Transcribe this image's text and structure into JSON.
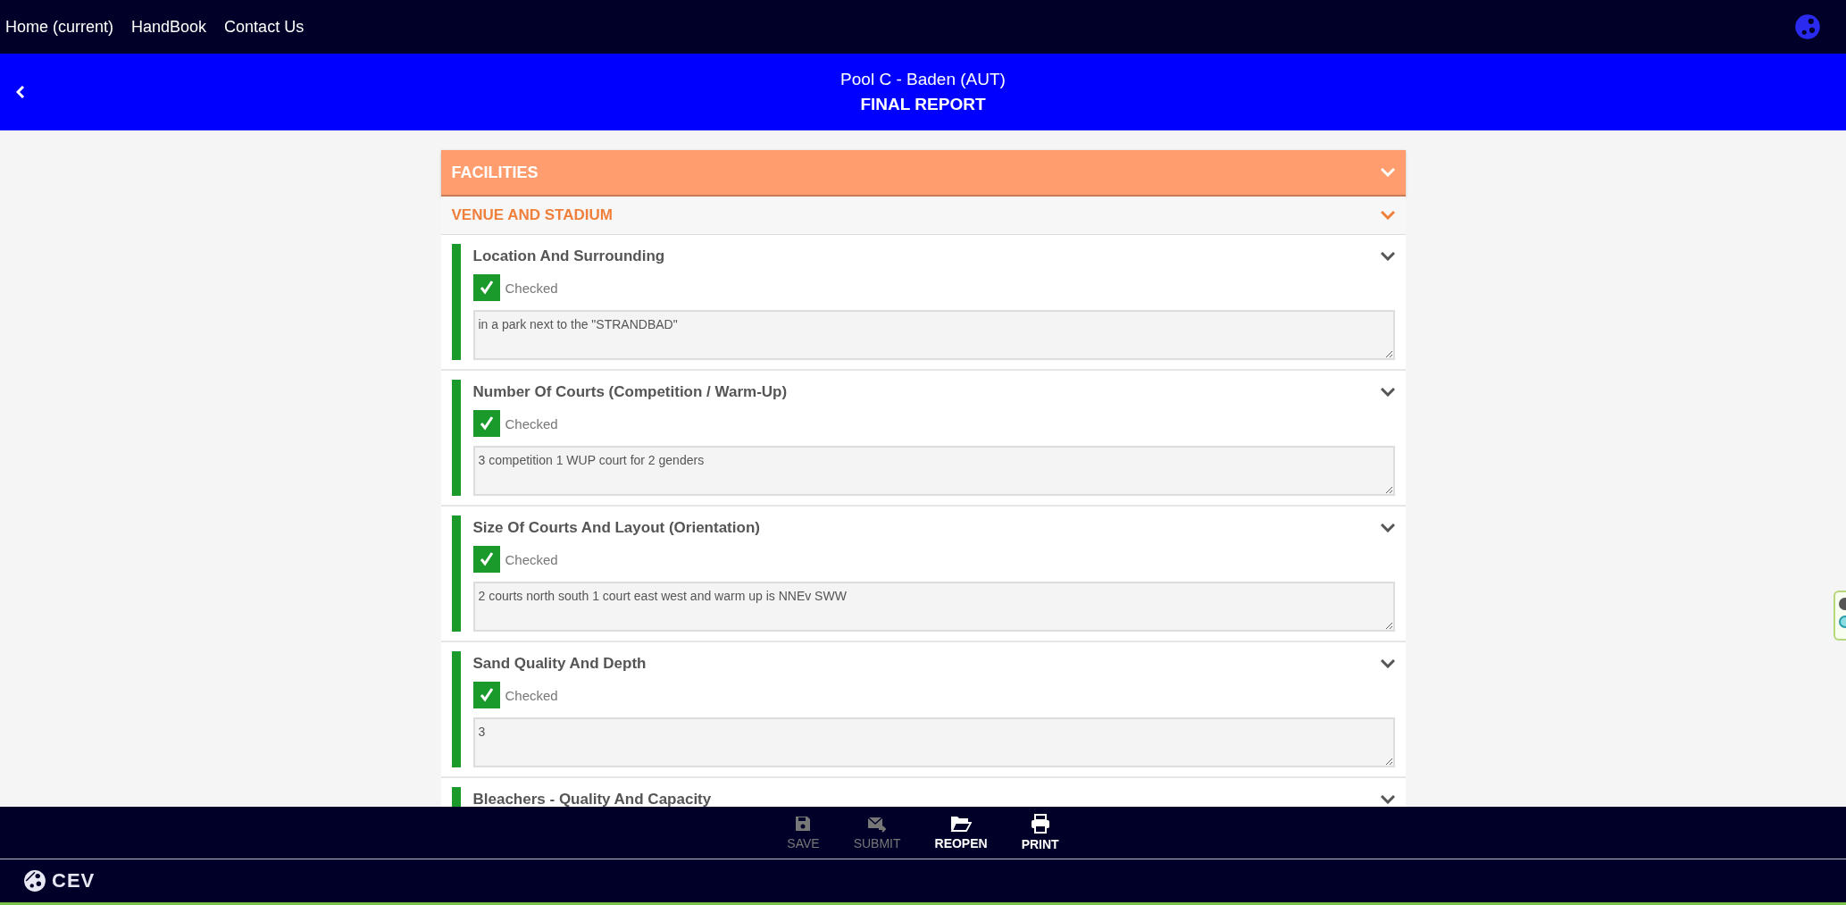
{
  "nav": {
    "links": [
      {
        "label": "Home (current)"
      },
      {
        "label": "HandBook"
      },
      {
        "label": "Contact Us"
      }
    ]
  },
  "header": {
    "title": "Pool C - Baden (AUT)",
    "subtitle": "FINAL REPORT"
  },
  "section": {
    "title": "FACILITIES"
  },
  "subsection": {
    "title": "VENUE AND STADIUM"
  },
  "items": [
    {
      "title": "Location And Surrounding",
      "checked": true,
      "check_label": "Checked",
      "value": "in a park next to the \"STRANDBAD\""
    },
    {
      "title": "Number Of Courts (Competition / Warm-Up)",
      "checked": true,
      "check_label": "Checked",
      "value": "3 competition 1 WUP court for 2 genders"
    },
    {
      "title": "Size Of Courts And Layout (Orientation)",
      "checked": true,
      "check_label": "Checked",
      "value": "2 courts north south 1 court east west and warm up is NNEv SWW"
    },
    {
      "title": "Sand Quality And Depth",
      "checked": true,
      "check_label": "Checked",
      "value": "3"
    },
    {
      "title": "Bleachers - Quality And Capacity"
    }
  ],
  "toolbar": [
    {
      "kind": "save",
      "label": "SAVE",
      "disabled": true
    },
    {
      "kind": "submit",
      "label": "SUBMIT",
      "disabled": true
    },
    {
      "kind": "reopen",
      "label": "REOPEN",
      "disabled": false
    },
    {
      "kind": "print",
      "label": "PRINT",
      "disabled": false
    }
  ],
  "footer": {
    "brand": "CEV"
  }
}
